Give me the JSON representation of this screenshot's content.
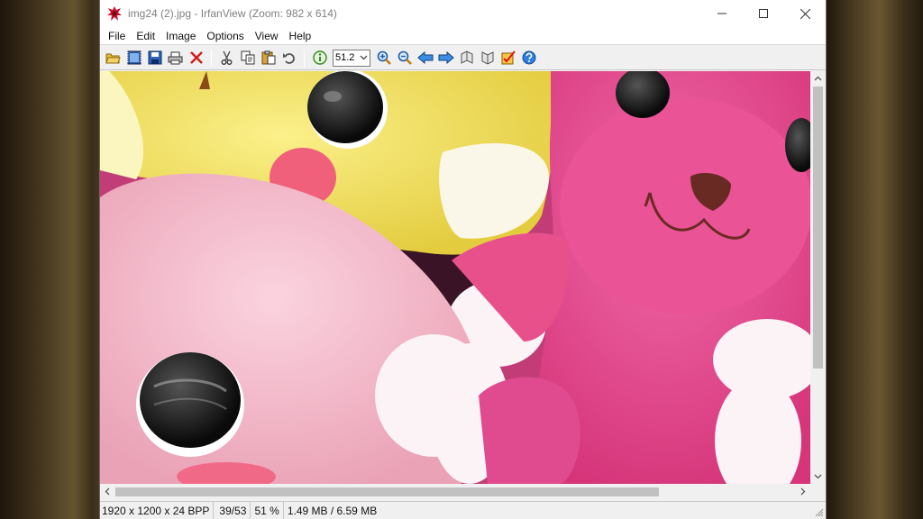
{
  "window": {
    "title": "img24 (2).jpg - IrfanView (Zoom: 982 x 614)",
    "controls": {
      "minimize": "minimize",
      "maximize": "maximize",
      "close": "close"
    }
  },
  "menu": [
    "File",
    "Edit",
    "Image",
    "Options",
    "View",
    "Help"
  ],
  "toolbar": {
    "zoom_value": "51.2",
    "icons": [
      "open-folder-icon",
      "slideshow-icon",
      "save-icon",
      "print-icon",
      "delete-icon",
      "cut-icon",
      "copy-icon",
      "paste-icon",
      "undo-icon",
      "info-icon",
      "zoom-in-icon",
      "zoom-out-icon",
      "previous-icon",
      "next-icon",
      "first-page-icon",
      "last-page-icon",
      "properties-icon",
      "help-icon"
    ]
  },
  "image": {
    "description_icon": "plush-toys-photo",
    "colors": {
      "yellow": "#f0de5a",
      "pink_light": "#f4b8c8",
      "pink_hot": "#e84890",
      "white": "#ffffff"
    }
  },
  "status": {
    "dimensions": "1920 x 1200 x 24 BPP",
    "index": "39/53",
    "zoom": "51 %",
    "size": "1.49 MB / 6.59 MB"
  },
  "scroll": {
    "vertical_fraction": 0.68,
    "horizontal_fraction": 0.79
  }
}
